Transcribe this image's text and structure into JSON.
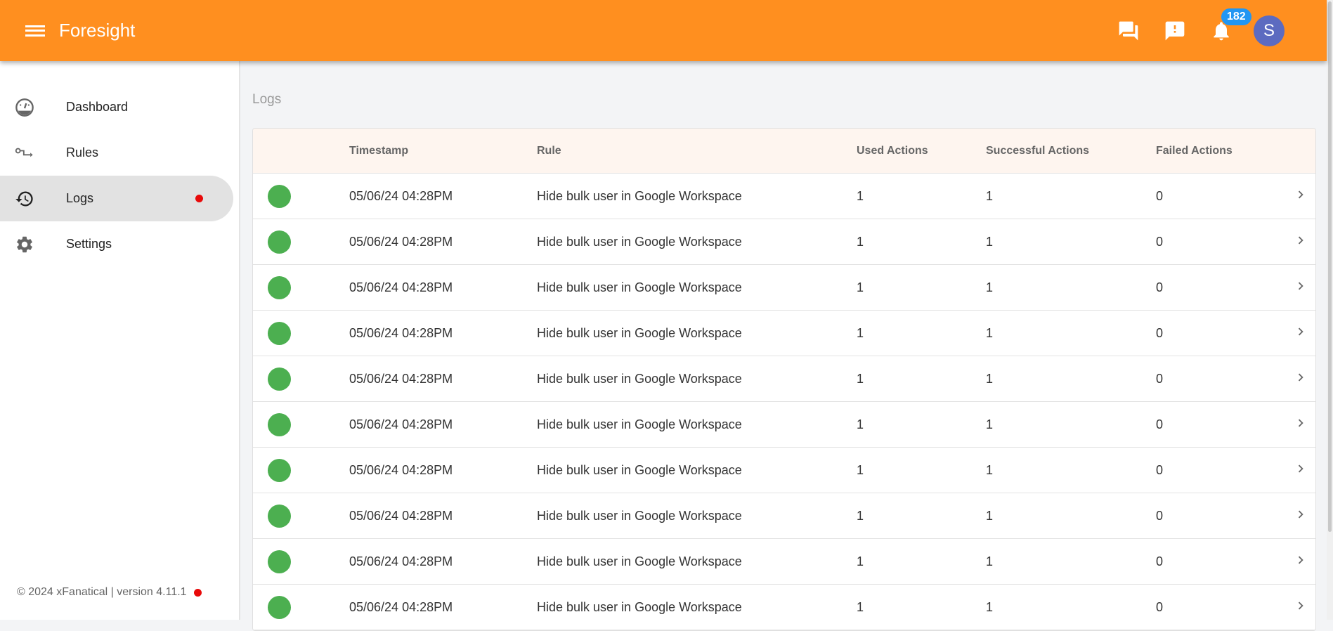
{
  "app": {
    "title": "Foresight",
    "notification_count": "182",
    "avatar_letter": "S"
  },
  "sidebar": {
    "items": [
      {
        "label": "Dashboard",
        "icon": "speedometer-icon"
      },
      {
        "label": "Rules",
        "icon": "rules-flow-icon"
      },
      {
        "label": "Logs",
        "icon": "history-icon",
        "active": true
      },
      {
        "label": "Settings",
        "icon": "gear-icon"
      }
    ],
    "footer": "© 2024 xFanatical | version 4.11.1"
  },
  "page": {
    "title": "Logs"
  },
  "table": {
    "columns": [
      "Timestamp",
      "Rule",
      "Used Actions",
      "Successful Actions",
      "Failed Actions"
    ],
    "rows": [
      {
        "timestamp": "05/06/24 04:28PM",
        "rule": "Hide bulk user in Google Workspace",
        "used": "1",
        "successful": "1",
        "failed": "0"
      },
      {
        "timestamp": "05/06/24 04:28PM",
        "rule": "Hide bulk user in Google Workspace",
        "used": "1",
        "successful": "1",
        "failed": "0"
      },
      {
        "timestamp": "05/06/24 04:28PM",
        "rule": "Hide bulk user in Google Workspace",
        "used": "1",
        "successful": "1",
        "failed": "0"
      },
      {
        "timestamp": "05/06/24 04:28PM",
        "rule": "Hide bulk user in Google Workspace",
        "used": "1",
        "successful": "1",
        "failed": "0"
      },
      {
        "timestamp": "05/06/24 04:28PM",
        "rule": "Hide bulk user in Google Workspace",
        "used": "1",
        "successful": "1",
        "failed": "0"
      },
      {
        "timestamp": "05/06/24 04:28PM",
        "rule": "Hide bulk user in Google Workspace",
        "used": "1",
        "successful": "1",
        "failed": "0"
      },
      {
        "timestamp": "05/06/24 04:28PM",
        "rule": "Hide bulk user in Google Workspace",
        "used": "1",
        "successful": "1",
        "failed": "0"
      },
      {
        "timestamp": "05/06/24 04:28PM",
        "rule": "Hide bulk user in Google Workspace",
        "used": "1",
        "successful": "1",
        "failed": "0"
      },
      {
        "timestamp": "05/06/24 04:28PM",
        "rule": "Hide bulk user in Google Workspace",
        "used": "1",
        "successful": "1",
        "failed": "0"
      },
      {
        "timestamp": "05/06/24 04:28PM",
        "rule": "Hide bulk user in Google Workspace",
        "used": "1",
        "successful": "1",
        "failed": "0"
      }
    ]
  },
  "colors": {
    "brand": "#ff8f1f",
    "success": "#4caf50",
    "badge": "#2196f3",
    "avatar": "#5c6bc0",
    "alert_dot": "#e80a0a"
  }
}
